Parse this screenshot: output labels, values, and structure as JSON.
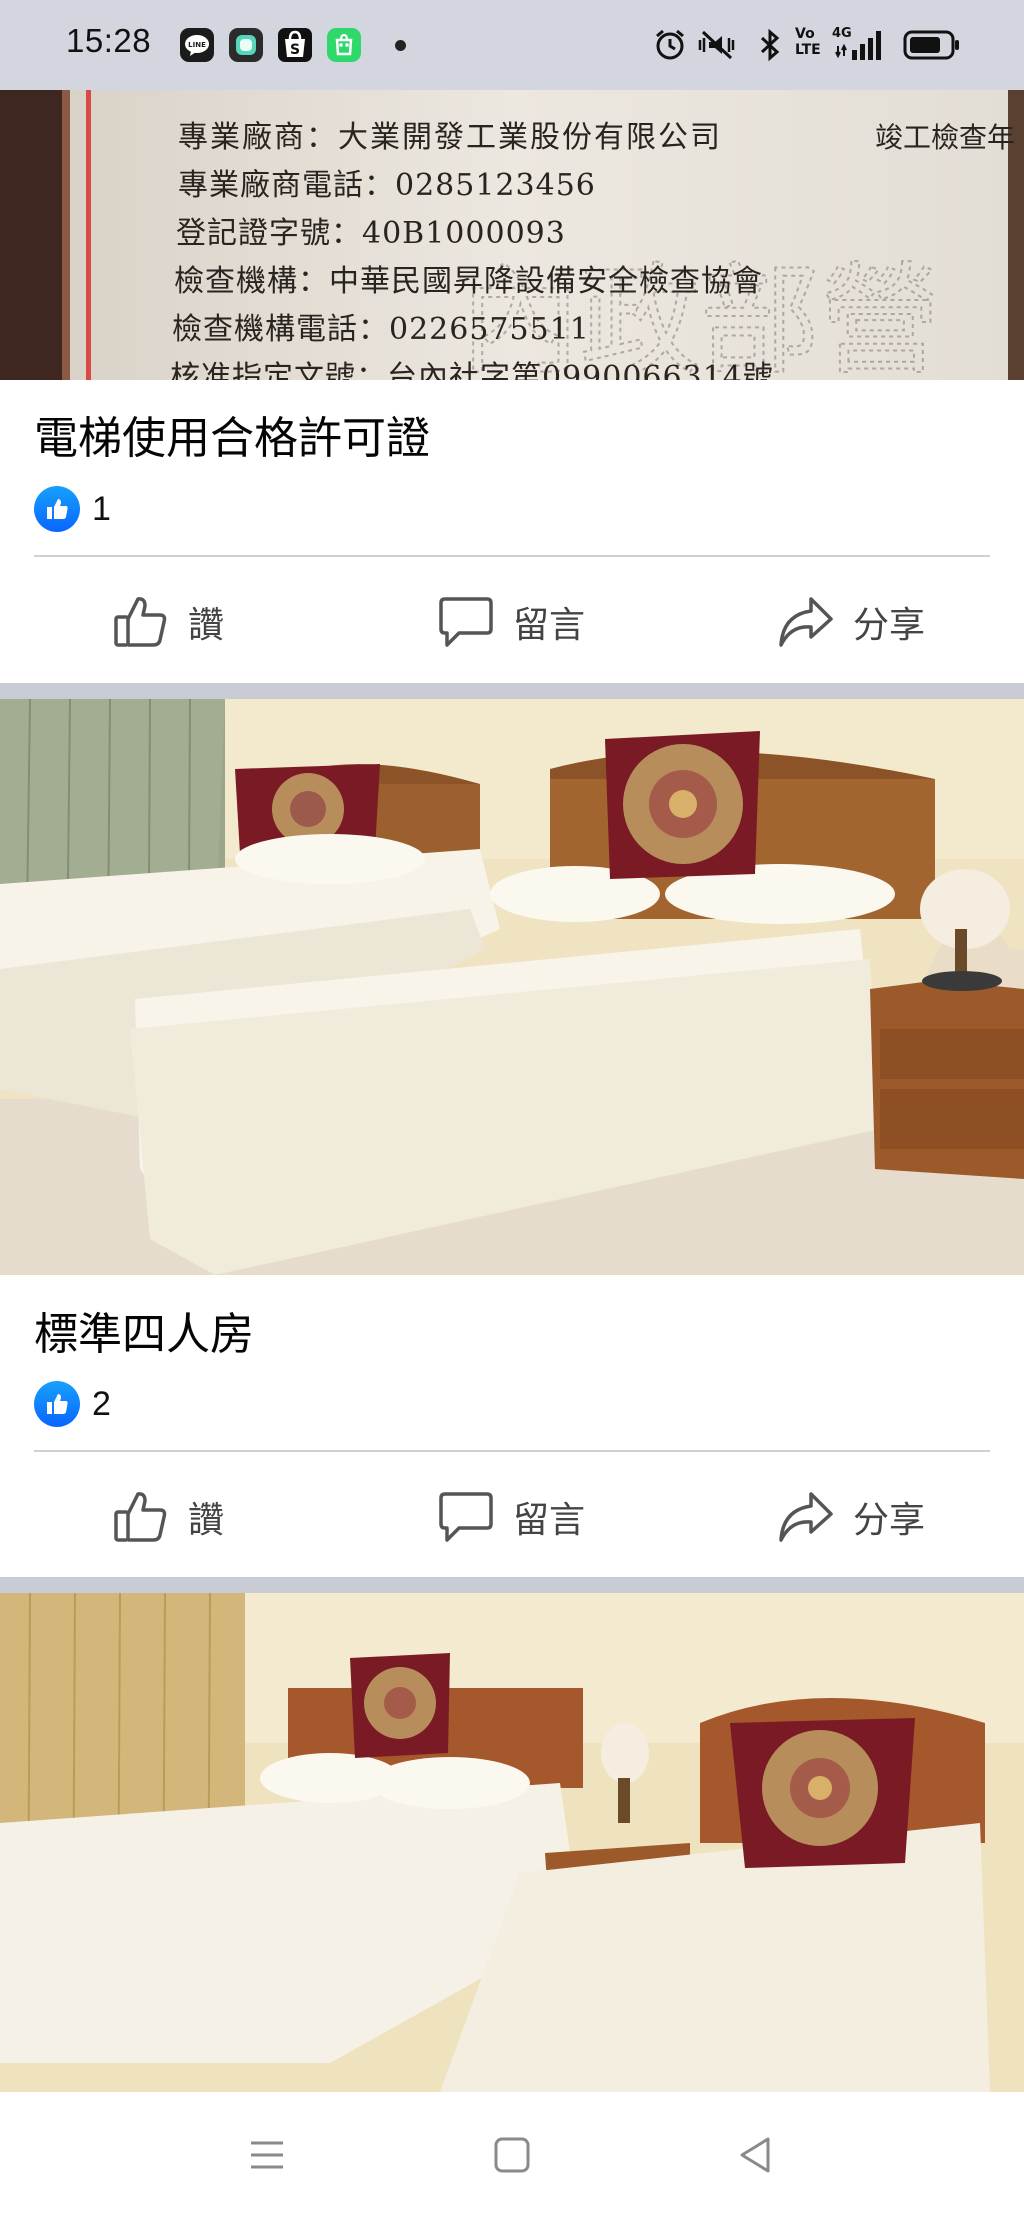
{
  "status_bar": {
    "time": "15:28",
    "left_icons": [
      "line-icon",
      "chat-app-icon",
      "shopee-icon",
      "store-app-icon"
    ],
    "right_icons": [
      "alarm-icon",
      "mute-vibrate-icon",
      "bluetooth-icon",
      "volte-icon",
      "4g-signal-icon",
      "battery-icon"
    ],
    "volte_label": "Vo LTE",
    "network_label": "4G"
  },
  "posts": [
    {
      "image_text": [
        "專業廠商：大業開發工業股份有限公司",
        "竣工檢查年",
        "專業廠商電話：0285123456",
        "登記證字號：40B1000093",
        "檢查機構：中華民國昇降設備安全檢查協會",
        "檢查機構電話：0226575511",
        "核准指定文號：台內社字第0990066314號"
      ],
      "title": "電梯使用合格許可證",
      "reaction_count": "1"
    },
    {
      "title": "標準四人房",
      "reaction_count": "2"
    }
  ],
  "actions": {
    "like": "讚",
    "comment": "留言",
    "share": "分享"
  },
  "colors": {
    "like_blue": "#0866ff",
    "separator": "#c9ccd4",
    "status_bar_bg": "#d3d6de"
  }
}
